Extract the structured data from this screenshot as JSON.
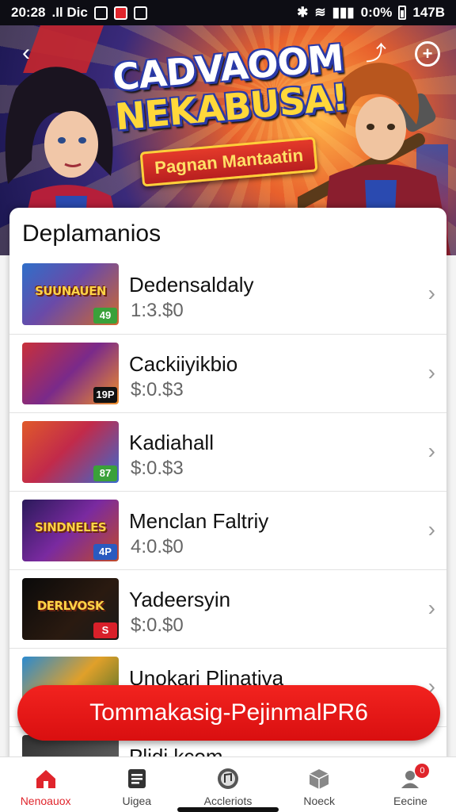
{
  "status_bar": {
    "time": "20:28",
    "carrier": ".Il Dic",
    "battery_percent": "0:0%",
    "battery_label": "147B"
  },
  "hero": {
    "title_line1": "CADVAOOM",
    "title_line2": "NEKABUSA!",
    "subtitle": "Pagnan Mantaatin"
  },
  "section": {
    "title": "Deplamanios"
  },
  "items": [
    {
      "title": "Dedensaldaly",
      "price": "1:3.$0",
      "thumb_text": "SUUNAUEN",
      "badge": "49",
      "badge_color": "#3aa13a",
      "thumb_bg": "linear-gradient(135deg,#2f6fc9,#6a4aa8 45%,#d06a2c)"
    },
    {
      "title": "Cackiiyikbio",
      "price": "$:0.$3",
      "thumb_text": "",
      "badge": "19P",
      "badge_color": "#111111",
      "thumb_bg": "linear-gradient(135deg,#c9303a,#7a2a8a 50%,#f0902a)"
    },
    {
      "title": "Kadiahall",
      "price": "$:0.$3",
      "thumb_text": "",
      "badge": "87",
      "badge_color": "#3aa13a",
      "thumb_bg": "linear-gradient(135deg,#e05a2a,#c22a4a 45%,#3a6ad0)"
    },
    {
      "title": "Menclan Faltriy",
      "price": "4:0.$0",
      "thumb_text": "SINDNELES",
      "badge": "4P",
      "badge_color": "#2a5ac0",
      "thumb_bg": "linear-gradient(135deg,#2a1a5a,#7a2aa0 50%,#c04a2a)"
    },
    {
      "title": "Yadeersyin",
      "price": "$:0.$0",
      "thumb_text": "DERLVOSK",
      "badge": "S",
      "badge_color": "#d9202a",
      "thumb_bg": "linear-gradient(135deg,#0a0a0a,#2a1a10 60%,#1a1a1a)"
    },
    {
      "title": "Unokari Plinativa",
      "price": "",
      "thumb_text": "",
      "badge": "",
      "badge_color": "#3aa13a",
      "thumb_bg": "linear-gradient(135deg,#2a8ad0,#e0a02a 50%,#3a6a2a)"
    },
    {
      "title": "Plidi kcom",
      "price": "",
      "thumb_text": "",
      "badge": "",
      "badge_color": "#333333",
      "thumb_bg": "linear-gradient(135deg,#333,#666)"
    }
  ],
  "cta": {
    "label": "Tommakasig-PejinmalPR6"
  },
  "nav": [
    {
      "label": "Nenoauox",
      "icon": "home-icon"
    },
    {
      "label": "Uigea",
      "icon": "document-icon"
    },
    {
      "label": "Accleriots",
      "icon": "music-icon"
    },
    {
      "label": "Noeck",
      "icon": "box-icon"
    },
    {
      "label": "Eecine",
      "icon": "profile-icon",
      "badge": "0"
    }
  ],
  "colors": {
    "accent": "#e0252c",
    "cta_top": "#f2231f",
    "cta_bottom": "#d90f10"
  }
}
